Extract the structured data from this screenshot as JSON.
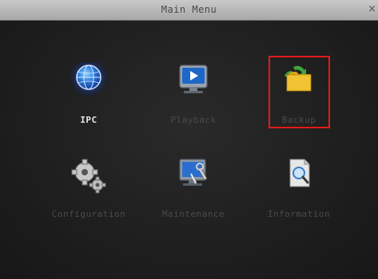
{
  "window": {
    "title": "Main Menu",
    "close_label": "×"
  },
  "menu": {
    "items": [
      {
        "label": "IPC",
        "icon": "ipc-globe-icon",
        "selected": true
      },
      {
        "label": "Playback",
        "icon": "playback-monitor-icon"
      },
      {
        "label": "Backup",
        "icon": "backup-folder-icon",
        "highlighted": true
      },
      {
        "label": "Configuration",
        "icon": "gears-icon"
      },
      {
        "label": "Maintenance",
        "icon": "maintenance-wrench-monitor-icon"
      },
      {
        "label": "Information",
        "icon": "information-magnifier-icon"
      }
    ]
  },
  "colors": {
    "highlight_border": "#e21a1a",
    "selected_label": "#e8e8e8",
    "inactive_label": "#4a4a4a"
  }
}
